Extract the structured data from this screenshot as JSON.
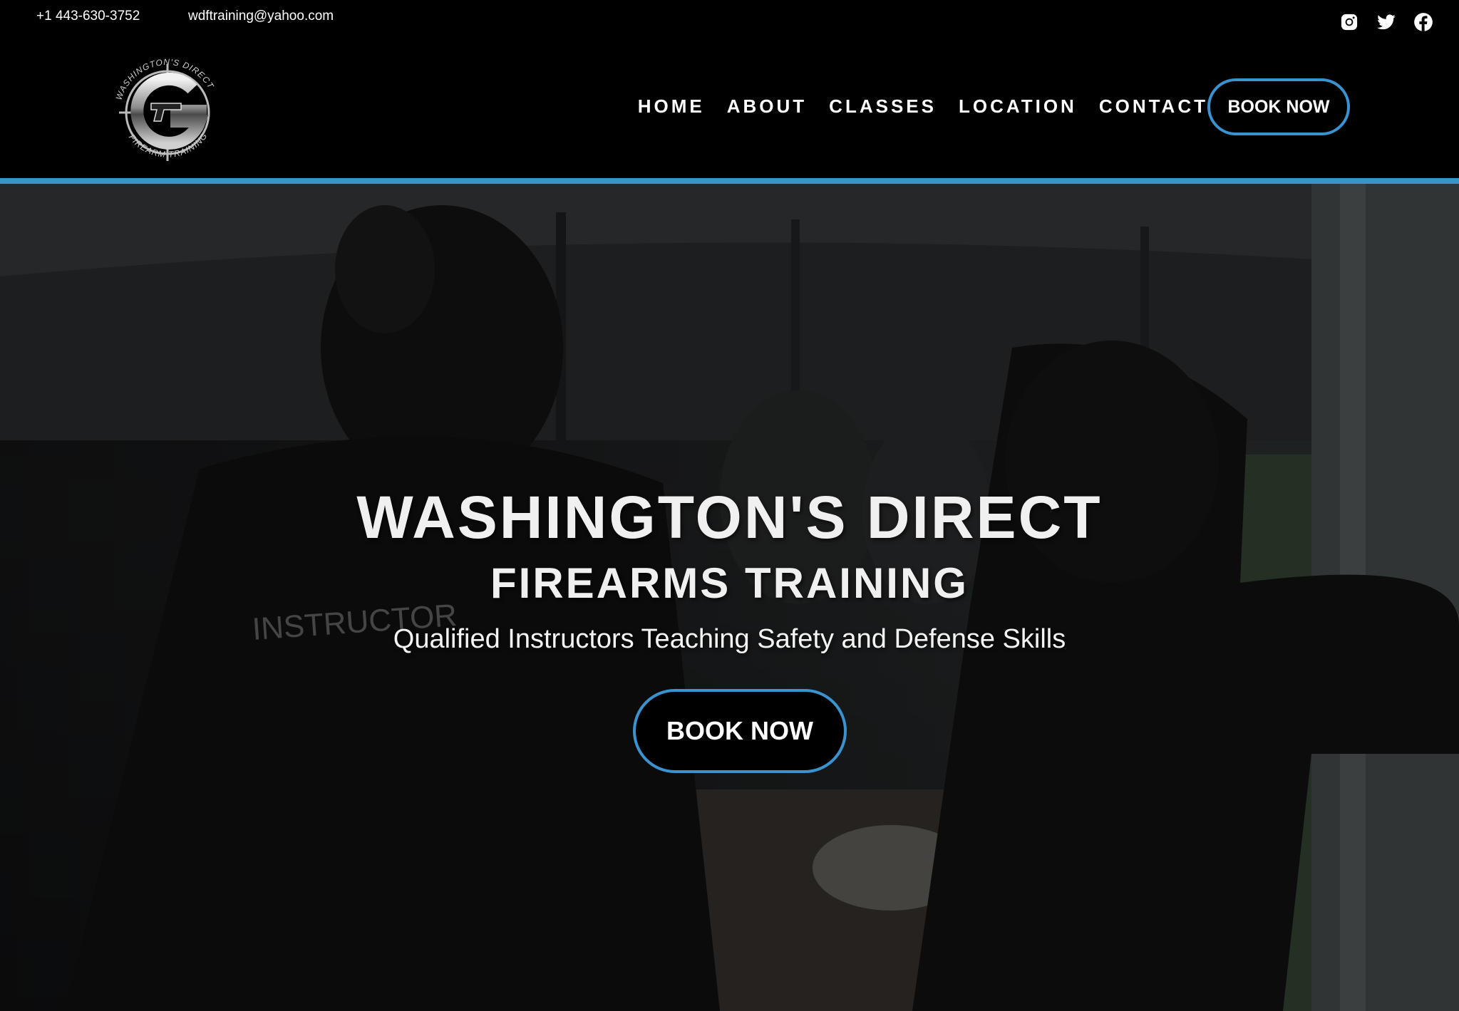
{
  "topbar": {
    "phone": "+1 443-630-3752",
    "email": "wdftraining@yahoo.com",
    "social_icons": [
      "instagram-icon",
      "twitter-icon",
      "facebook-icon"
    ]
  },
  "logo": {
    "ring_top_text": "WASHINGTON'S DIRECT",
    "ring_bottom_text": "FIREARM TRAINING",
    "letter": "G"
  },
  "nav": {
    "items": [
      "HOME",
      "ABOUT",
      "CLASSES",
      "LOCATION",
      "CONTACT"
    ],
    "book_label": "BOOK NOW"
  },
  "hero": {
    "title": "WASHINGTON'S DIRECT",
    "subtitle": "FIREARMS TRAINING",
    "tagline": "Qualified Instructors Teaching Safety and Defense Skills",
    "book_label": "BOOK NOW",
    "jacket_text": "INSTRUCTOR"
  },
  "colors": {
    "accent": "#3a93cf",
    "background": "#000000",
    "text": "#ffffff"
  }
}
